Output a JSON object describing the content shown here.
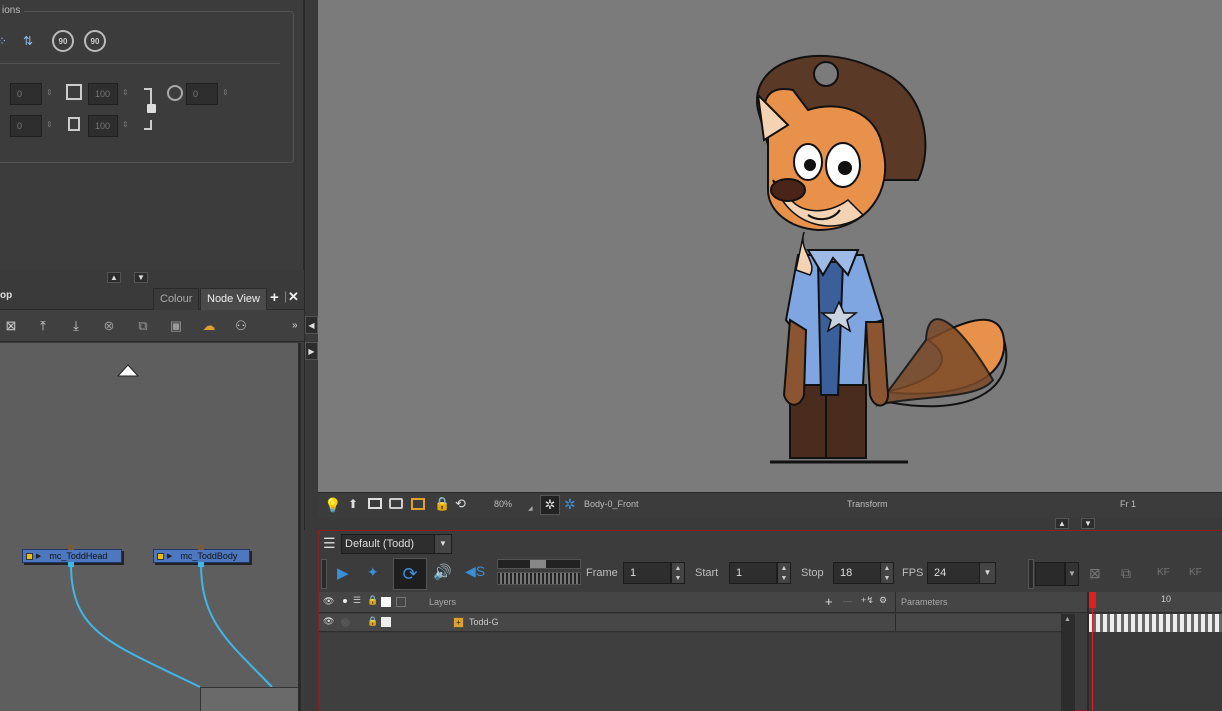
{
  "props": {
    "group_title": "ions",
    "fields": [
      "0",
      "100",
      "0",
      "0",
      "100"
    ],
    "rot_cw": "90",
    "rot_ccw": "90"
  },
  "nodeview": {
    "panel_title": "op",
    "tabs": [
      "Colour",
      "Node View"
    ],
    "nodes": [
      {
        "label": "mc_ToddHead"
      },
      {
        "label": "mc_ToddBody"
      }
    ]
  },
  "camera": {
    "zoom": "80%",
    "layer": "Body-0_Front",
    "tool": "Transform",
    "frame": "Fr 1"
  },
  "timeline": {
    "scene": "Default (Todd)",
    "frame_label": "Frame",
    "frame": "1",
    "start_label": "Start",
    "start": "1",
    "stop_label": "Stop",
    "stop": "18",
    "fps_label": "FPS",
    "fps": "24",
    "layers_label": "Layers",
    "params_label": "Parameters",
    "layer_name": "Todd-G",
    "ruler_10": "10",
    "kf1": "KF",
    "kf2": "KF"
  },
  "colors": {
    "accent_blue": "#3a8fd8",
    "node_blue": "#4d78c0",
    "wire": "#3fb7e8",
    "playhead": "#e02020"
  }
}
